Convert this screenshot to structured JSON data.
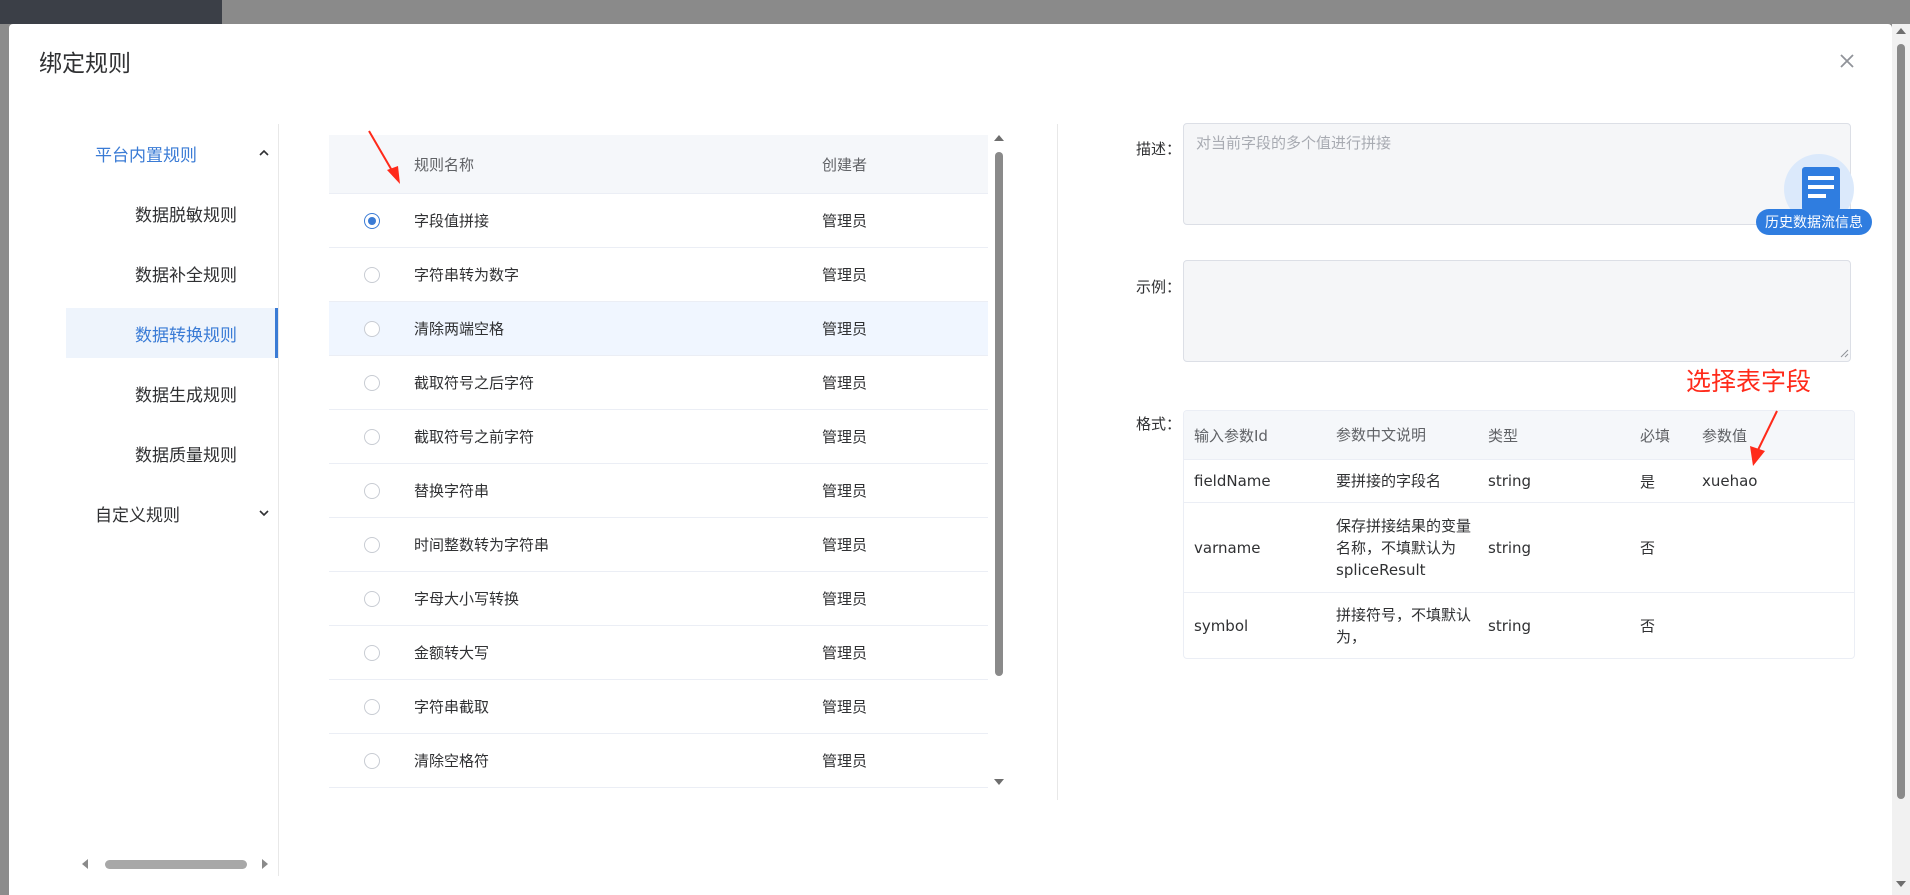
{
  "dialog": {
    "title": "绑定规则",
    "close_icon": "close-icon"
  },
  "nav": {
    "groups": [
      {
        "label": "平台内置规则",
        "icon": "chevron-up-icon",
        "expanded": true
      },
      {
        "label": "自定义规则",
        "icon": "chevron-down-icon",
        "expanded": false
      }
    ],
    "items": [
      {
        "label": "数据脱敏规则"
      },
      {
        "label": "数据补全规则"
      },
      {
        "label": "数据转换规则",
        "active": true
      },
      {
        "label": "数据生成规则"
      },
      {
        "label": "数据质量规则"
      }
    ]
  },
  "rule_table": {
    "headers": {
      "name": "规则名称",
      "creator": "创建者"
    },
    "rows": [
      {
        "name": "字段值拼接",
        "creator": "管理员",
        "selected": true
      },
      {
        "name": "字符串转为数字",
        "creator": "管理员"
      },
      {
        "name": "清除两端空格",
        "creator": "管理员"
      },
      {
        "name": "截取符号之后字符",
        "creator": "管理员"
      },
      {
        "name": "截取符号之前字符",
        "creator": "管理员"
      },
      {
        "name": "替换字符串",
        "creator": "管理员"
      },
      {
        "name": "时间整数转为字符串",
        "creator": "管理员"
      },
      {
        "name": "字母大小写转换",
        "creator": "管理员"
      },
      {
        "name": "金额转大写",
        "creator": "管理员"
      },
      {
        "name": "字符串截取",
        "creator": "管理员"
      },
      {
        "name": "清除空格符",
        "creator": "管理员"
      }
    ]
  },
  "form": {
    "desc_label": "描述：",
    "desc_value": "对当前字段的多个值进行拼接",
    "example_label": "示例：",
    "example_value": "",
    "format_label": "格式：",
    "history_badge": "历史数据流信息"
  },
  "param_table": {
    "headers": {
      "id": "输入参数Id",
      "desc": "参数中文说明",
      "type": "类型",
      "required": "必填",
      "value": "参数值"
    },
    "rows": [
      {
        "id": "fieldName",
        "desc": "要拼接的字段名",
        "type": "string",
        "required": "是",
        "value": "xuehao"
      },
      {
        "id": "varname",
        "desc": "保存拼接结果的变量名称，不填默认为 spliceResult",
        "type": "string",
        "required": "否",
        "value": ""
      },
      {
        "id": "symbol",
        "desc": "拼接符号，不填默认为，",
        "type": "string",
        "required": "否",
        "value": ""
      }
    ]
  },
  "annotation": {
    "text": "选择表字段",
    "color": "#ff2a1a"
  },
  "colors": {
    "accent": "#3a7bd5",
    "badge": "#2f7de0"
  }
}
